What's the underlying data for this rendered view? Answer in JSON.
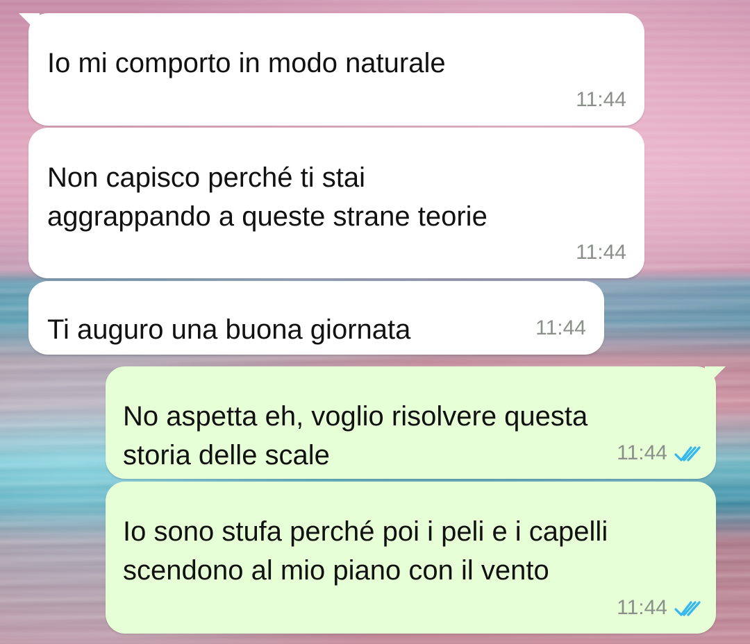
{
  "messages": [
    {
      "text": "Io mi comporto in modo naturale",
      "time": "11:44"
    },
    {
      "text": "Non capisco perché ti stai\naggrappando a queste strane teorie",
      "time": "11:44"
    },
    {
      "text": "Ti auguro una buona giornata",
      "time": "11:44"
    },
    {
      "text": "No aspetta eh, voglio risolvere questa\nstoria delle scale",
      "time": "11:44"
    },
    {
      "text": "Io sono stufa perché poi i peli e i capelli\nscendono al mio piano con il vento",
      "time": "11:44"
    }
  ],
  "icons": {
    "read_receipt": "double-check-icon"
  },
  "colors": {
    "incoming_bubble": "#ffffff",
    "outgoing_bubble": "#e6ffd7",
    "timestamp": "#8a8f8a",
    "read_tick": "#34b7f1"
  }
}
